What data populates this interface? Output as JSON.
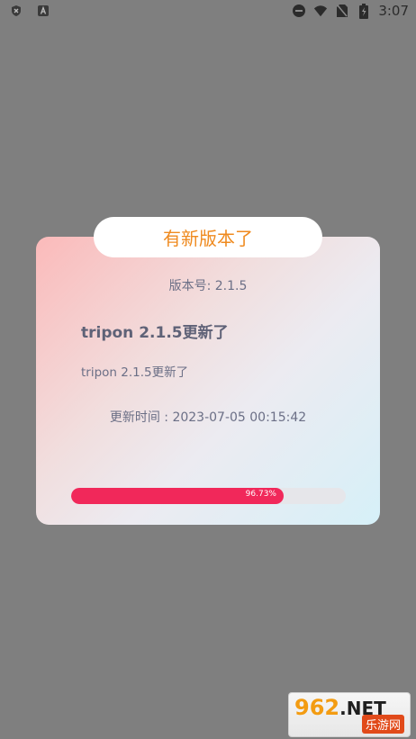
{
  "status_bar": {
    "time": "3:07",
    "icons": [
      "shield-x-icon",
      "a-icon",
      "dnd-icon",
      "wifi-icon",
      "no-sim-icon",
      "battery-charging-icon"
    ]
  },
  "dialog": {
    "title": "有新版本了",
    "version_label": "版本号: 2.1.5",
    "headline": "tripon 2.1.5更新了",
    "description": "tripon 2.1.5更新了",
    "update_time": "更新时间 : 2023-07-05 00:15:42",
    "progress": {
      "percent": 96.73,
      "label": "96.73%"
    },
    "colors": {
      "title": "#ef8a1f",
      "progress": "#f1285a"
    }
  },
  "watermark": {
    "brand": "962",
    "net": ".NET",
    "site": "乐游网"
  }
}
